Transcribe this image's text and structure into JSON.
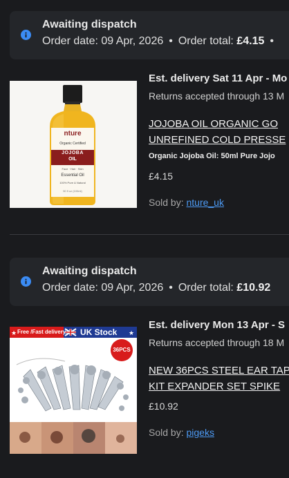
{
  "orders": [
    {
      "status": "Awaiting dispatch",
      "order_date_label": "Order date: 09 Apr, 2026",
      "order_total_label": "Order total:",
      "order_total_value": "£4.15",
      "delivery": "Est. delivery Sat 11 Apr - Mo",
      "returns": "Returns accepted through 13 M",
      "title_line1": "JOJOBA OIL ORGANIC GO",
      "title_line2": "UNREFINED COLD PRESSE",
      "subtitle": "Organic Jojoba Oil: 50ml Pure Jojo",
      "price": "£4.15",
      "sold_by_label": "Sold by:",
      "seller": "nture_uk",
      "image": {
        "brand": "nture",
        "certified": "Organic Certified",
        "label_line1": "JOJOBA",
        "label_line2": "OIL",
        "attrs": "Face · Hair · Skin",
        "essential": "Essential Oil",
        "purity": "100% Pure & Natural",
        "volume": "50 fl oz (100ml)"
      }
    },
    {
      "status": "Awaiting dispatch",
      "order_date_label": "Order date: 09 Apr, 2026",
      "order_total_label": "Order total:",
      "order_total_value": "£10.92",
      "delivery": "Est. delivery Mon 13 Apr - S",
      "returns": "Returns accepted through 18 M",
      "title_line1": "NEW 36PCS STEEL EAR TAP",
      "title_line2": "KIT EXPANDER SET SPIKE",
      "price": "£10.92",
      "sold_by_label": "Sold by:",
      "seller": "pigeks",
      "image": {
        "free_delivery": "Free /Fast delivery",
        "uk_stock": "UK Stock",
        "badge": "36PCS"
      }
    }
  ],
  "colors": {
    "background": "#1a1b1e",
    "banner": "#24262a",
    "info_icon": "#3b8cf5",
    "link": "#4d9bf5"
  }
}
